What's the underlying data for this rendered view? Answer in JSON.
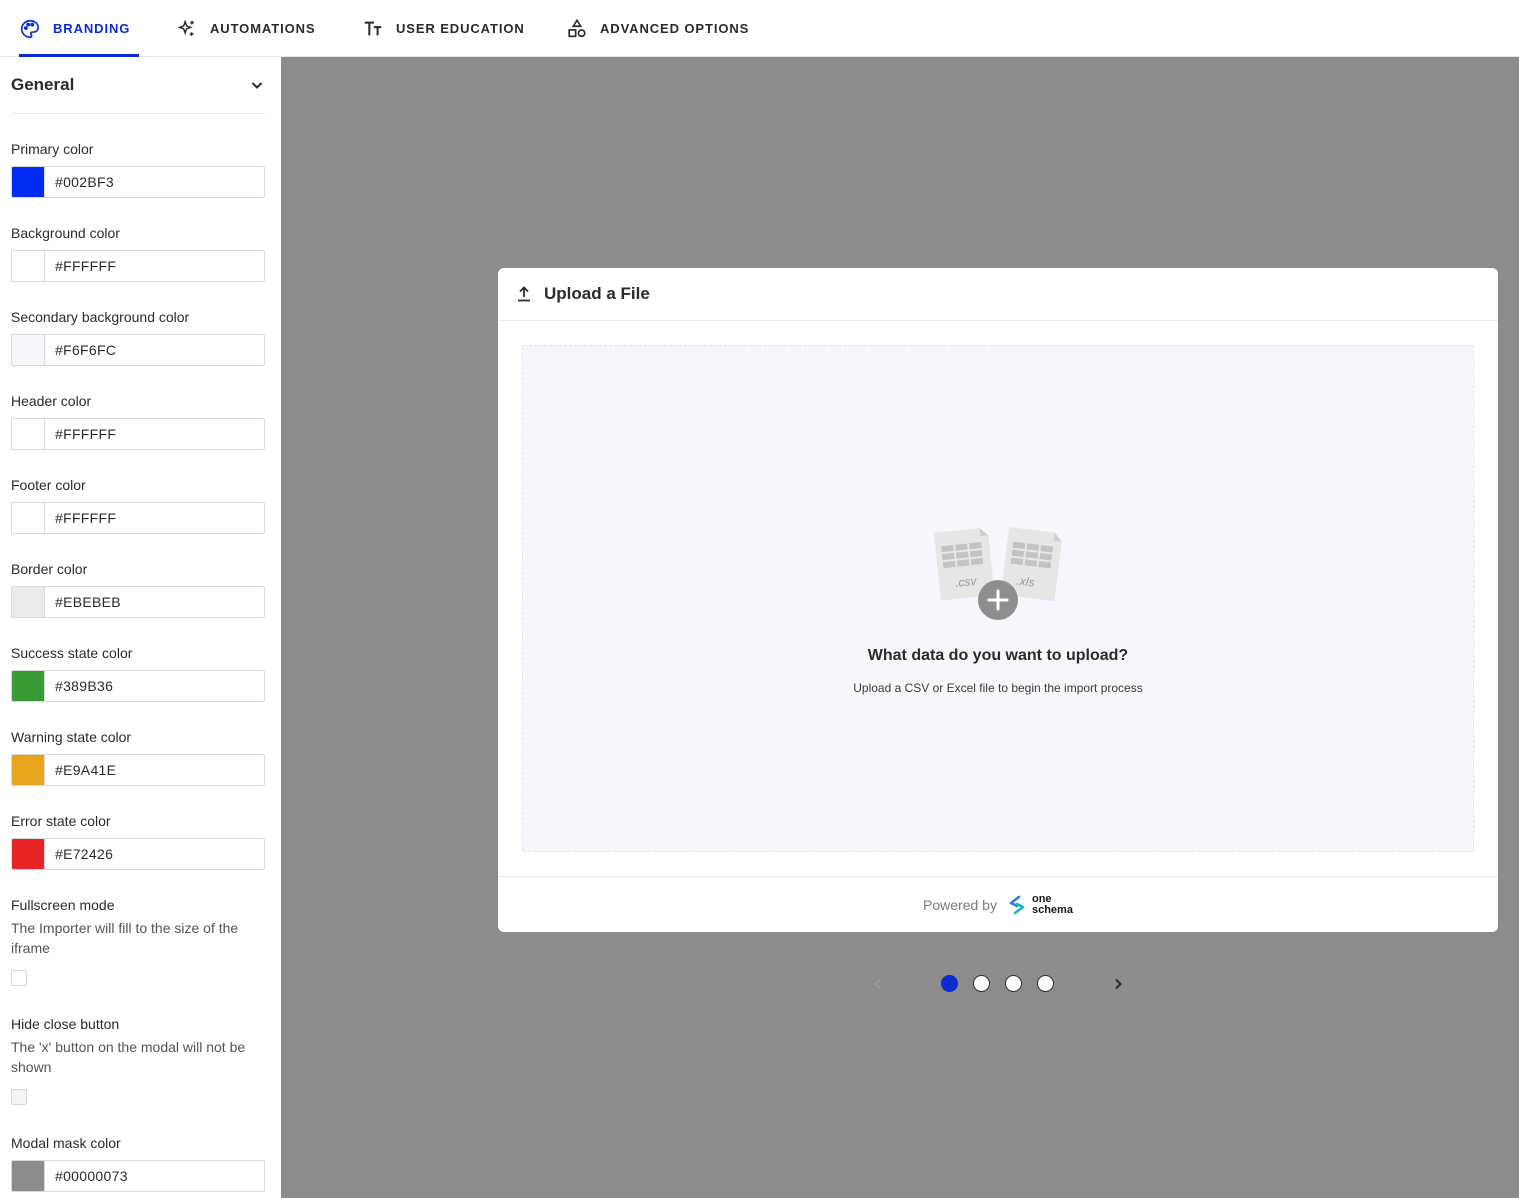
{
  "tabs": [
    {
      "label": "BRANDING",
      "icon": "palette-icon",
      "active": true
    },
    {
      "label": "AUTOMATIONS",
      "icon": "sparkles-icon",
      "active": false
    },
    {
      "label": "USER EDUCATION",
      "icon": "text-size-icon",
      "active": false
    },
    {
      "label": "ADVANCED OPTIONS",
      "icon": "shapes-icon",
      "active": false
    }
  ],
  "sidebar": {
    "section_title": "General",
    "colors": [
      {
        "label": "Primary color",
        "value": "#002BF3"
      },
      {
        "label": "Background color",
        "value": "#FFFFFF"
      },
      {
        "label": "Secondary background color",
        "value": "#F6F6FC"
      },
      {
        "label": "Header color",
        "value": "#FFFFFF"
      },
      {
        "label": "Footer color",
        "value": "#FFFFFF"
      },
      {
        "label": "Border color",
        "value": "#EBEBEB"
      },
      {
        "label": "Success state color",
        "value": "#389B36"
      },
      {
        "label": "Warning state color",
        "value": "#E9A41E"
      },
      {
        "label": "Error state color",
        "value": "#E72426"
      }
    ],
    "fullscreen": {
      "title": "Fullscreen mode",
      "description": "The Importer will fill to the size of the iframe",
      "checked": false
    },
    "hide_close": {
      "title": "Hide close button",
      "description": "The 'x' button on the modal will not be shown",
      "checked": false
    },
    "modal_mask": {
      "label": "Modal mask color",
      "value": "#00000073"
    }
  },
  "modal": {
    "title": "Upload a File",
    "icon": "upload-icon",
    "drop_title": "What data do you want to upload?",
    "drop_subtitle": "Upload a CSV or Excel file to begin the import process",
    "file_tag_1": ".csv",
    "file_tag_2": ".xls",
    "powered_by": "Powered by",
    "brand_line1": "one",
    "brand_line2": "schema"
  },
  "pager": {
    "count": 4,
    "active_index": 0
  },
  "theme": {
    "accent": "#0a2bd6",
    "mask": "#8c8c8c"
  }
}
